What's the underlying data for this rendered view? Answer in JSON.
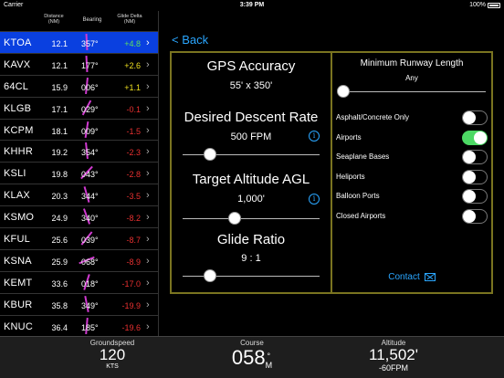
{
  "status": {
    "carrier": "Carrier",
    "time": "3:39 PM",
    "battery": "100%"
  },
  "list": {
    "headers": {
      "distance": "Distance (NM)",
      "bearing": "Bearing",
      "glide": "Glide Delta (NM)"
    },
    "rows": [
      {
        "id": "KTOA",
        "dist": "12.1",
        "bear": "357°",
        "glide": "+4.8",
        "glide_color": "#5ee05e",
        "selected": true
      },
      {
        "id": "KAVX",
        "dist": "12.1",
        "bear": "177°",
        "glide": "+2.6",
        "glide_color": "#f0e020"
      },
      {
        "id": "64CL",
        "dist": "15.9",
        "bear": "006°",
        "glide": "+1.1",
        "glide_color": "#f0e020"
      },
      {
        "id": "KLGB",
        "dist": "17.1",
        "bear": "029°",
        "glide": "-0.1",
        "glide_color": "#e83030"
      },
      {
        "id": "KCPM",
        "dist": "18.1",
        "bear": "009°",
        "glide": "-1.5",
        "glide_color": "#e83030"
      },
      {
        "id": "KHHR",
        "dist": "19.2",
        "bear": "354°",
        "glide": "-2.3",
        "glide_color": "#e83030"
      },
      {
        "id": "KSLI",
        "dist": "19.8",
        "bear": "043°",
        "glide": "-2.8",
        "glide_color": "#e83030"
      },
      {
        "id": "KLAX",
        "dist": "20.3",
        "bear": "344°",
        "glide": "-3.5",
        "glide_color": "#e83030"
      },
      {
        "id": "KSMO",
        "dist": "24.9",
        "bear": "340°",
        "glide": "-8.2",
        "glide_color": "#e83030"
      },
      {
        "id": "KFUL",
        "dist": "25.6",
        "bear": "039°",
        "glide": "-8.7",
        "glide_color": "#e83030"
      },
      {
        "id": "KSNA",
        "dist": "25.9",
        "bear": "068°",
        "glide": "-8.9",
        "glide_color": "#e83030"
      },
      {
        "id": "KEMT",
        "dist": "33.6",
        "bear": "018°",
        "glide": "-17.0",
        "glide_color": "#e83030"
      },
      {
        "id": "KBUR",
        "dist": "35.8",
        "bear": "349°",
        "glide": "-19.9",
        "glide_color": "#e83030"
      },
      {
        "id": "KNUC",
        "dist": "36.4",
        "bear": "185°",
        "glide": "-19.6",
        "glide_color": "#e83030"
      }
    ]
  },
  "back_label": "< Back",
  "settings": {
    "gps_title": "GPS Accuracy",
    "gps_value": "55' x 350'",
    "descent_title": "Desired Descent Rate",
    "descent_value": "500 FPM",
    "descent_level": 0.2,
    "altitude_title": "Target Altitude AGL",
    "altitude_value": "1,000'",
    "altitude_level": 0.38,
    "glide_title": "Glide Ratio",
    "glide_value": "9 : 1",
    "glide_level": 0.2,
    "runway_title": "Minimum Runway Length",
    "runway_value": "Any",
    "runway_level": 0.0,
    "toggles": [
      {
        "label": "Asphalt/Concrete Only",
        "on": false
      },
      {
        "label": "Airports",
        "on": true
      },
      {
        "label": "Seaplane Bases",
        "on": false
      },
      {
        "label": "Heliports",
        "on": false
      },
      {
        "label": "Balloon Ports",
        "on": false
      },
      {
        "label": "Closed Airports",
        "on": false
      }
    ],
    "contact_label": "Contact"
  },
  "bottom": {
    "groundspeed_title": "Groundspeed",
    "groundspeed_value": "120",
    "groundspeed_unit": "KTS",
    "course_title": "Course",
    "course_value": "058",
    "course_suffix": "°",
    "course_unit": "M",
    "altitude_title": "Altitude",
    "altitude_value": "11,502'",
    "altitude_rate": "-60FPM"
  },
  "colors": {
    "accent": "#2aa6ff",
    "frame": "#7a7420",
    "selected": "#0a40e0",
    "needle": "#d03ad0",
    "switch_on": "#4cd964"
  }
}
